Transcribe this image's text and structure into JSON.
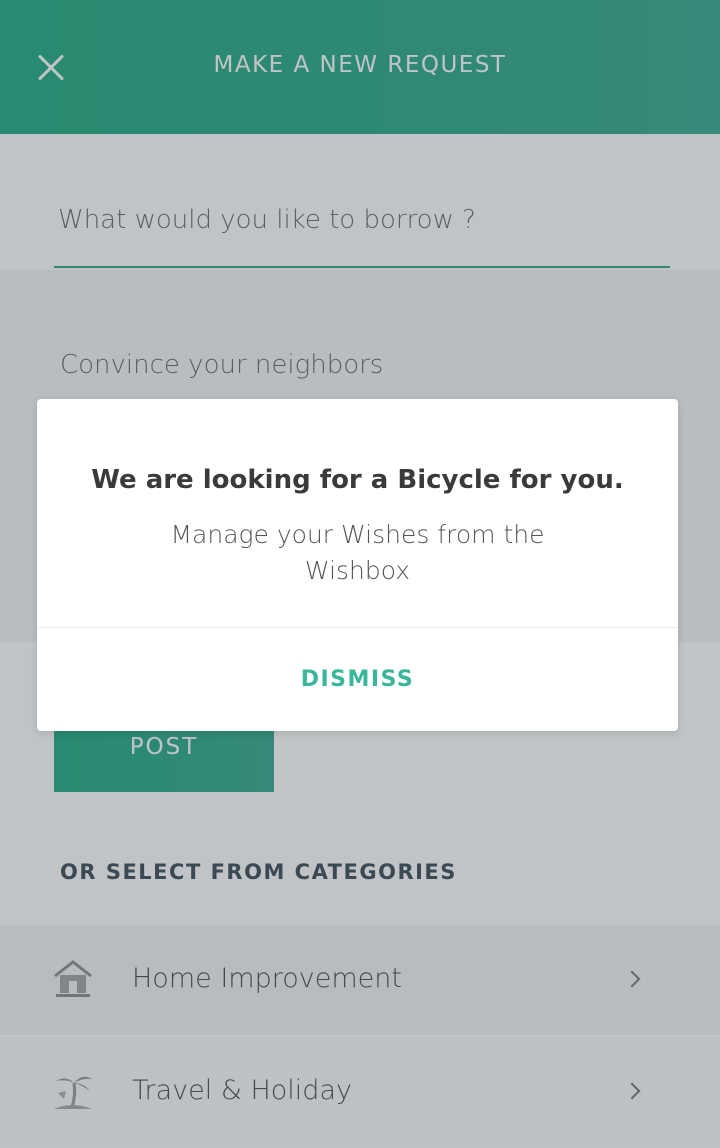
{
  "header": {
    "title": "MAKE A NEW REQUEST",
    "close_icon": "close-icon"
  },
  "form": {
    "borrow_placeholder": "What would you like to borrow ?",
    "convince_placeholder": "Convince your neighbors",
    "post_label": "POST"
  },
  "categories": {
    "title": "OR SELECT FROM CATEGORIES",
    "items": [
      {
        "label": "Home Improvement",
        "icon": "house-icon"
      },
      {
        "label": "Travel & Holiday",
        "icon": "palm-tree-icon"
      }
    ]
  },
  "dialog": {
    "title": "We are looking for a Bicycle for you.",
    "message": "Manage your Wishes from the Wishbox",
    "dismiss_label": "DISMISS"
  },
  "colors": {
    "accent": "#2aa685",
    "dismiss": "#3ab79a",
    "overlay": "rgba(60,70,78,0.32)"
  }
}
